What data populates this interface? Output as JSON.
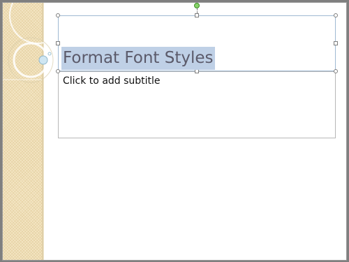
{
  "slide": {
    "title": "Format Font Styles",
    "subtitle_placeholder": "Click to add subtitle"
  },
  "colors": {
    "selection_highlight": "#bfd0e6",
    "title_text": "#5b5a6a",
    "rotation_handle": "#88d46a",
    "left_band": "#f4e6c4"
  }
}
